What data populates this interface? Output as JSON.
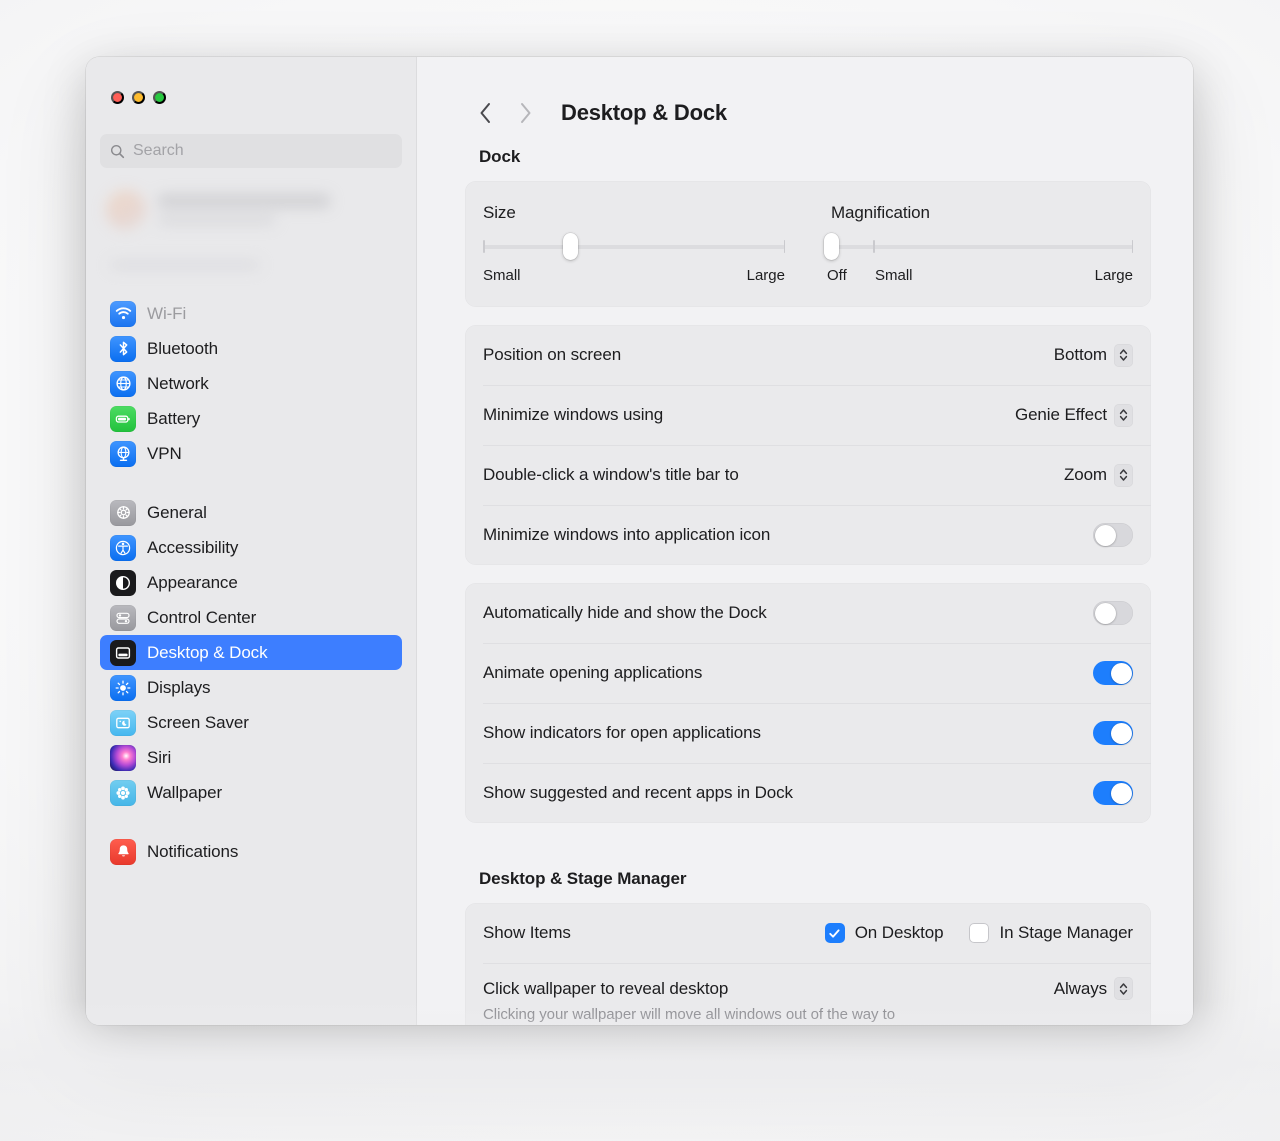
{
  "window": {
    "traffic_lights": [
      {
        "name": "close",
        "color": "#ff5f57"
      },
      {
        "name": "minimize",
        "color": "#febc2e"
      },
      {
        "name": "zoom",
        "color": "#28c840"
      }
    ]
  },
  "sidebar": {
    "search": {
      "placeholder": "Search",
      "value": "",
      "icon": "search-icon"
    },
    "account": {
      "redacted": true
    },
    "groups": [
      {
        "items": [
          {
            "label": "Wi-Fi",
            "icon": "wifi-icon",
            "dimmed": true,
            "selected": false
          },
          {
            "label": "Bluetooth",
            "icon": "bluetooth-icon",
            "dimmed": false,
            "selected": false
          },
          {
            "label": "Network",
            "icon": "network-globe-icon",
            "dimmed": false,
            "selected": false
          },
          {
            "label": "Battery",
            "icon": "battery-icon",
            "dimmed": false,
            "selected": false
          },
          {
            "label": "VPN",
            "icon": "vpn-globe-icon",
            "dimmed": false,
            "selected": false
          }
        ]
      },
      {
        "items": [
          {
            "label": "General",
            "icon": "gear-icon",
            "dimmed": false,
            "selected": false
          },
          {
            "label": "Accessibility",
            "icon": "accessibility-icon",
            "dimmed": false,
            "selected": false
          },
          {
            "label": "Appearance",
            "icon": "appearance-icon",
            "dimmed": false,
            "selected": false
          },
          {
            "label": "Control Center",
            "icon": "control-center-icon",
            "dimmed": false,
            "selected": false
          },
          {
            "label": "Desktop & Dock",
            "icon": "desktop-dock-icon",
            "dimmed": false,
            "selected": true
          },
          {
            "label": "Displays",
            "icon": "displays-icon",
            "dimmed": false,
            "selected": false
          },
          {
            "label": "Screen Saver",
            "icon": "screen-saver-icon",
            "dimmed": false,
            "selected": false
          },
          {
            "label": "Siri",
            "icon": "siri-icon",
            "dimmed": false,
            "selected": false
          },
          {
            "label": "Wallpaper",
            "icon": "wallpaper-icon",
            "dimmed": false,
            "selected": false
          }
        ]
      },
      {
        "items": [
          {
            "label": "Notifications",
            "icon": "notifications-bell-icon",
            "dimmed": false,
            "selected": false
          }
        ]
      }
    ]
  },
  "nav": {
    "back_label": "Back",
    "forward_label": "Forward",
    "back_enabled": true,
    "forward_enabled": false,
    "title": "Desktop & Dock"
  },
  "dock_section": {
    "heading": "Dock",
    "sliders": [
      {
        "title": "Size",
        "value_percent": 29,
        "min_label": "Small",
        "max_label": "Large",
        "ticks": [
          0,
          100
        ]
      },
      {
        "title": "Magnification",
        "value_percent": 0,
        "off_label": "Off",
        "min_label": "Small",
        "max_label": "Large",
        "ticks": [
          14,
          100
        ]
      }
    ],
    "popup_rows": [
      {
        "label": "Position on screen",
        "value": "Bottom"
      },
      {
        "label": "Minimize windows using",
        "value": "Genie Effect"
      },
      {
        "label": "Double-click a window's title bar to",
        "value": "Zoom"
      }
    ],
    "minimize_into_icon": {
      "label": "Minimize windows into application icon",
      "on": false
    },
    "toggle_rows": [
      {
        "label": "Automatically hide and show the Dock",
        "on": false
      },
      {
        "label": "Animate opening applications",
        "on": true
      },
      {
        "label": "Show indicators for open applications",
        "on": true
      },
      {
        "label": "Show suggested and recent apps in Dock",
        "on": true
      }
    ]
  },
  "stage_manager_section": {
    "heading": "Desktop & Stage Manager",
    "show_items": {
      "label": "Show Items",
      "checkboxes": [
        {
          "label": "On Desktop",
          "checked": true
        },
        {
          "label": "In Stage Manager",
          "checked": false
        }
      ]
    },
    "click_wallpaper": {
      "label": "Click wallpaper to reveal desktop",
      "value": "Always",
      "caption": "Clicking your wallpaper will move all windows out of the way to"
    }
  },
  "colors": {
    "accent_blue": "#1d7efd",
    "selection_blue": "#3d7eff",
    "window_bg": "#f2f2f4",
    "sidebar_bg": "#e9e9eb",
    "card_bg": "#eaeaec"
  }
}
